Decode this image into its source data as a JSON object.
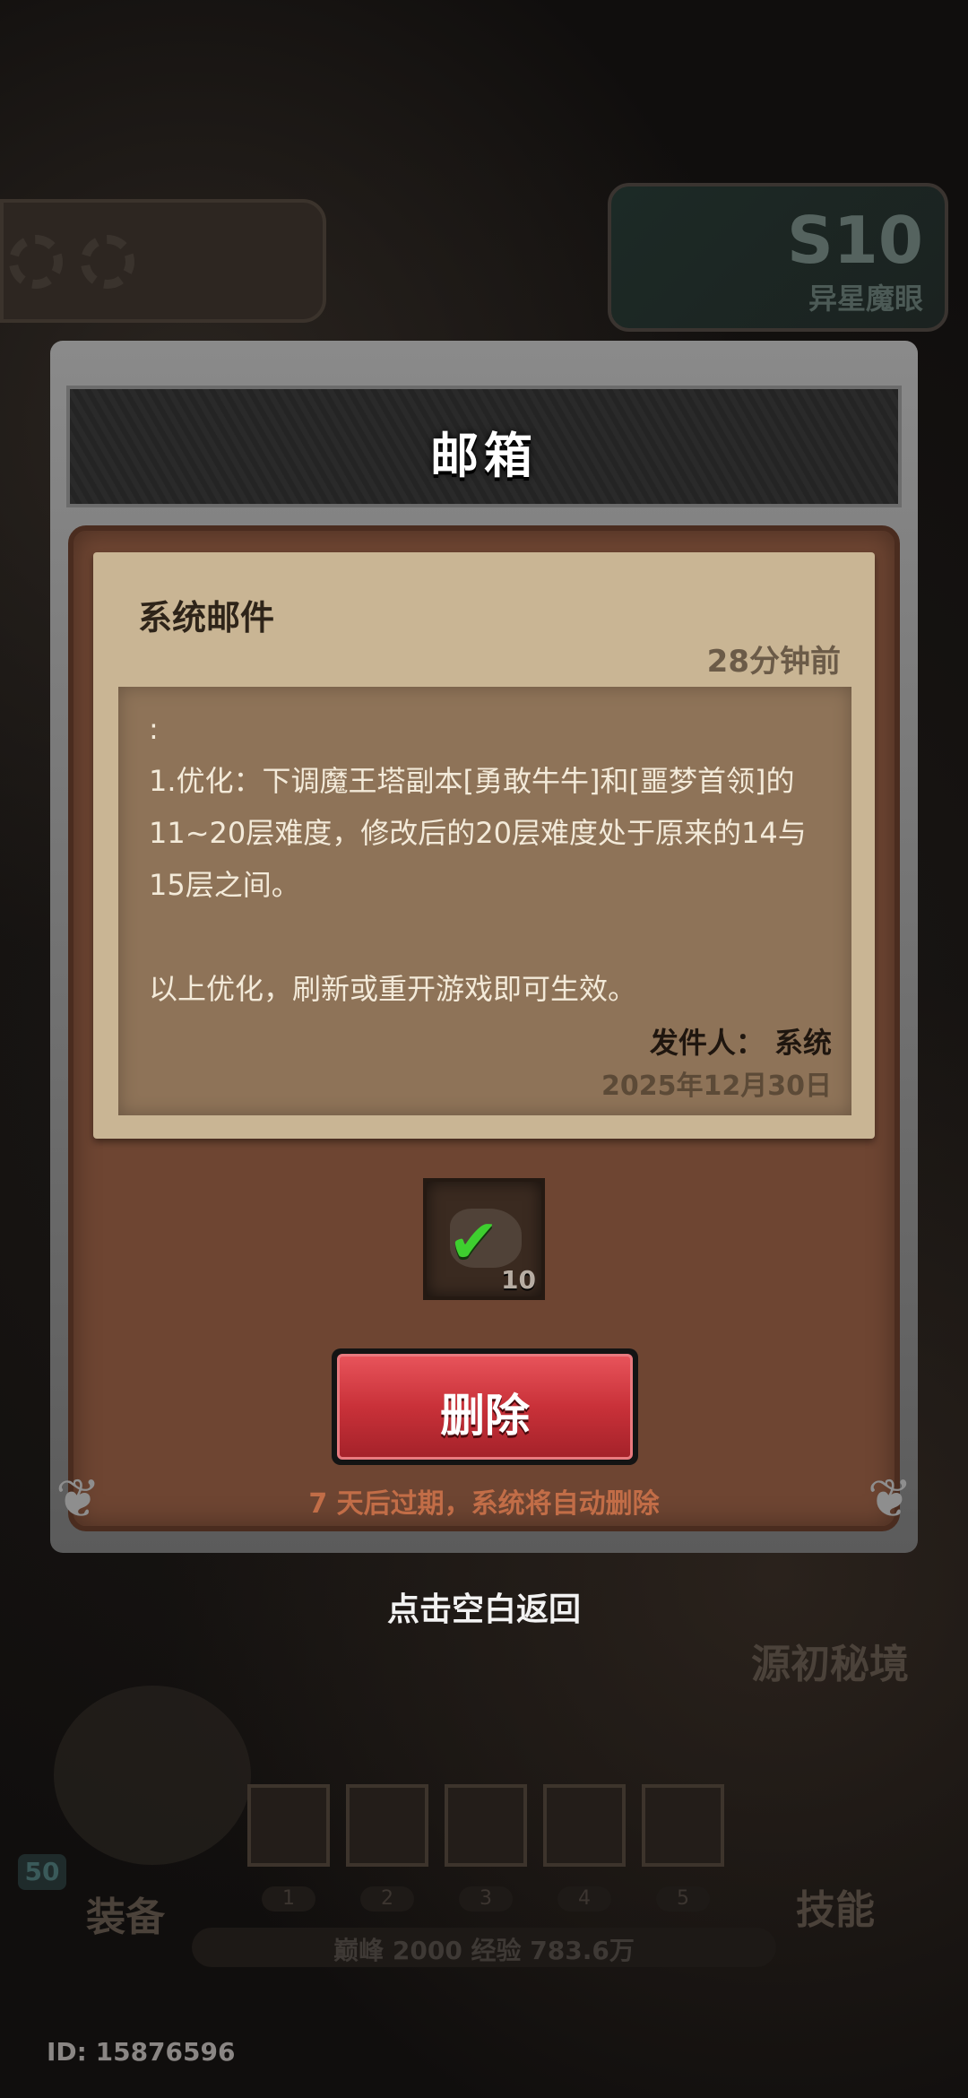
{
  "background": {
    "season_badge": "S10",
    "season_sub": "异星魔眼",
    "right_label": "源初秘境",
    "left_bottom_label": "装备",
    "right_bottom_label": "技能",
    "level_chip": "50",
    "skill_slots": [
      "1",
      "2",
      "3",
      "4",
      "5"
    ],
    "peak_text": "巅峰 2000   经验 783.6万",
    "player_id": "ID: 15876596"
  },
  "mailbox": {
    "title": "邮箱",
    "mail": {
      "title": "系统邮件",
      "time": "28分钟前",
      "content": ":\n1.优化：下调魔王塔副本[勇敢牛牛]和[噩梦首领]的11~20层难度，修改后的20层难度处于原来的14与15层之间。\n\n以上优化，刷新或重开游戏即可生效。",
      "sender": "发件人： 系统",
      "date": "2025年12月30日"
    },
    "reward": {
      "icon": "stone-icon",
      "claimed_icon": "checkmark-icon",
      "count": "10"
    },
    "delete_button": "删除",
    "expire_note": "7 天后过期，系统将自动删除"
  },
  "return_hint": "点击空白返回",
  "colors": {
    "paper": "#c9b594",
    "panel": "#6e4532",
    "delete_red": "#c93139",
    "check_green": "#3ecf2f",
    "expire_orange": "#c26d47"
  }
}
